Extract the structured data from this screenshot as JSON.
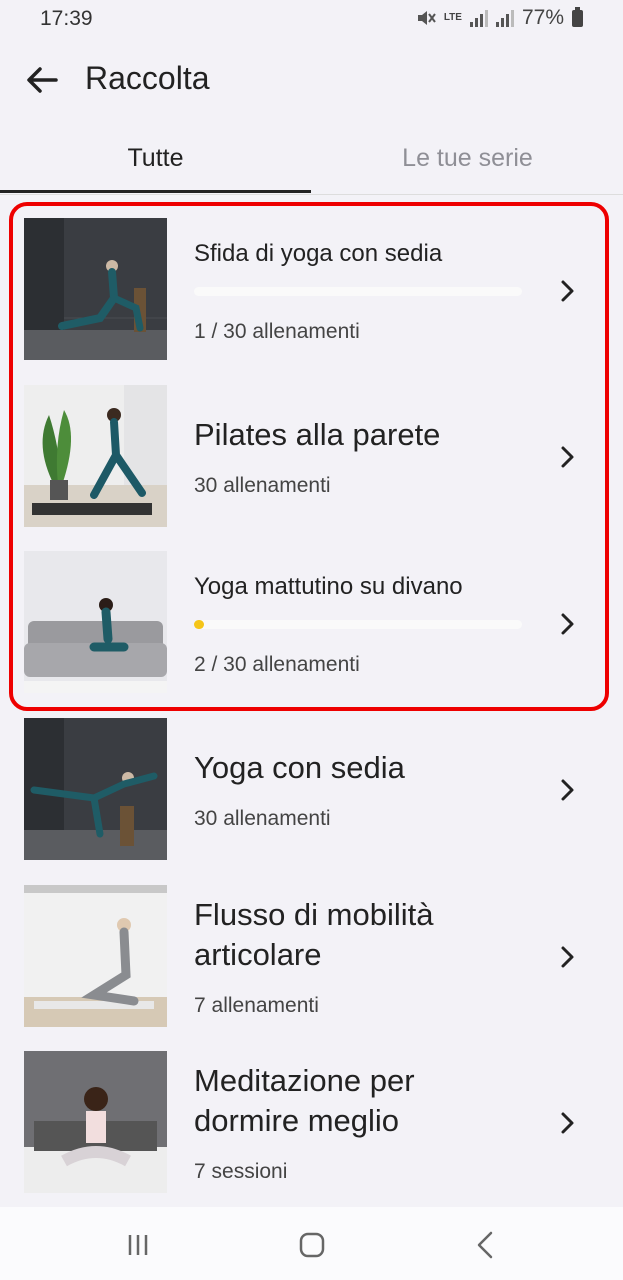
{
  "status_bar": {
    "time": "17:39",
    "network": "LTE",
    "battery": "77%"
  },
  "app_bar": {
    "title": "Raccolta"
  },
  "tabs": [
    {
      "label": "Tutte",
      "selected": true
    },
    {
      "label": "Le tue serie",
      "selected": false
    }
  ],
  "items": [
    {
      "title": "Sfida di yoga con sedia",
      "meta": "1 / 30 allenamenti",
      "progress": 0.0
    },
    {
      "title": "Pilates alla parete",
      "meta": "30 allenamenti"
    },
    {
      "title": "Yoga mattutino su divano",
      "meta": "2 / 30 allenamenti",
      "progress": 0.03
    },
    {
      "title": "Yoga con sedia",
      "meta": "30 allenamenti"
    },
    {
      "title_line1": "Flusso di mobilità",
      "title_line2": "articolare",
      "meta": "7 allenamenti"
    },
    {
      "title_line1": "Meditazione per",
      "title_line2": "dormire meglio",
      "meta": "7 sessioni"
    }
  ],
  "icons": {
    "back": "arrow-left-icon",
    "chevron": "chevron-right-icon"
  },
  "colors": {
    "highlight": "#ee0000",
    "progress": "#f5c518",
    "background": "#f3f2f7"
  }
}
